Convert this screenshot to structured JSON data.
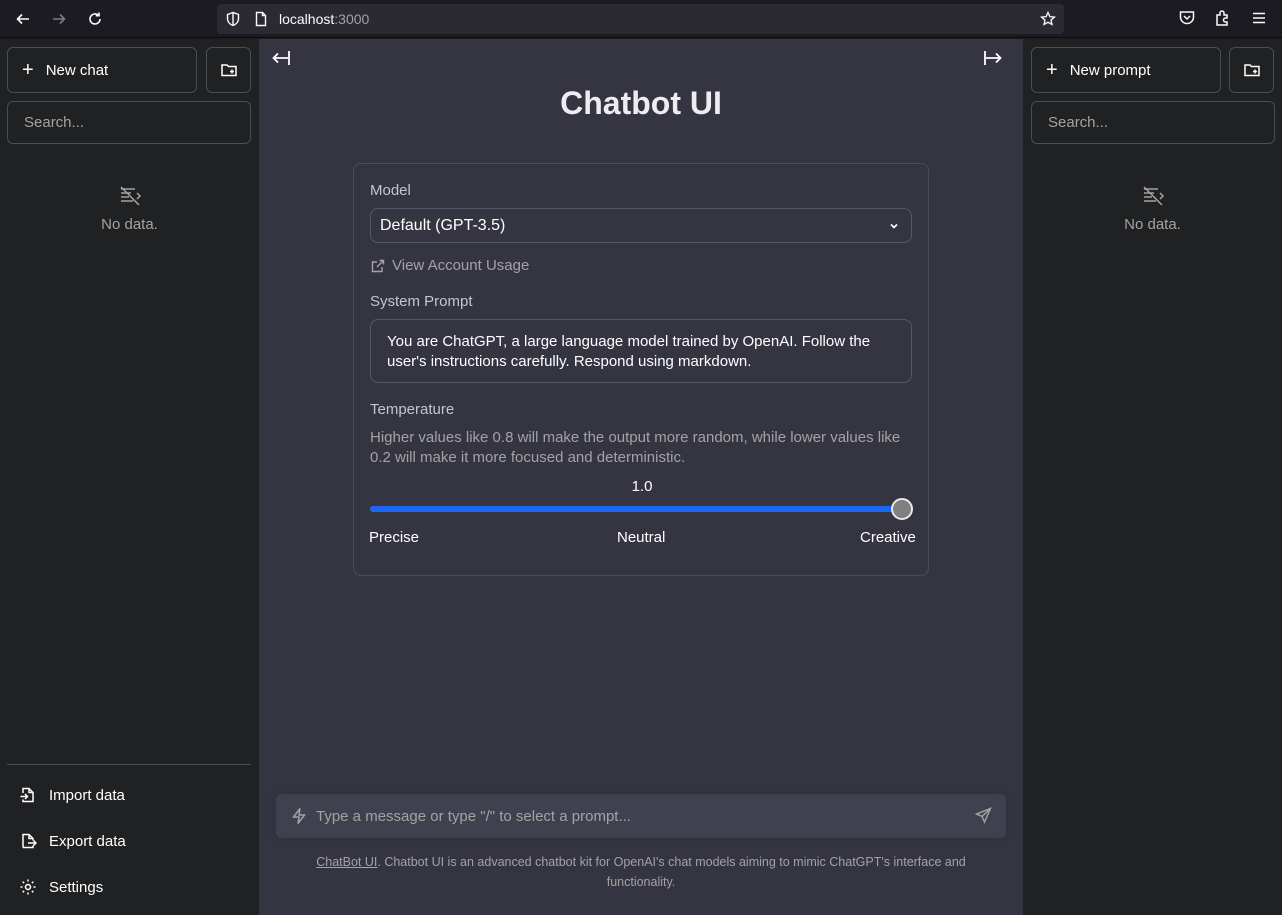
{
  "browser": {
    "url_host": "localhost",
    "url_port": ":3000"
  },
  "left_sidebar": {
    "new_button": "New chat",
    "search_placeholder": "Search...",
    "empty_text": "No data.",
    "menu": [
      {
        "label": "Import data",
        "icon": "file-import-icon"
      },
      {
        "label": "Export data",
        "icon": "file-export-icon"
      },
      {
        "label": "Settings",
        "icon": "gear-icon"
      }
    ]
  },
  "right_sidebar": {
    "new_button": "New prompt",
    "search_placeholder": "Search...",
    "empty_text": "No data."
  },
  "main": {
    "title": "Chatbot UI",
    "model_label": "Model",
    "model_value": "Default (GPT-3.5)",
    "usage_link": "View Account Usage",
    "system_prompt_label": "System Prompt",
    "system_prompt": "You are ChatGPT, a large language model trained by OpenAI. Follow the user's instructions carefully. Respond using markdown.",
    "temperature_label": "Temperature",
    "temperature_desc": "Higher values like 0.8 will make the output more random, while lower values like 0.2 will make it more focused and deterministic.",
    "temperature_value": "1.0",
    "temperature_fraction": 1.0,
    "scale": {
      "low": "Precise",
      "mid": "Neutral",
      "high": "Creative"
    },
    "input_placeholder": "Type a message or type \"/\" to select a prompt...",
    "footer_link": "ChatBot UI",
    "footer_text": ". Chatbot UI is an advanced chatbot kit for OpenAI's chat models aiming to mimic ChatGPT's interface and functionality."
  },
  "colors": {
    "accent": "#1a66f5",
    "main_bg": "#343541",
    "sidebar_bg": "#202123"
  }
}
